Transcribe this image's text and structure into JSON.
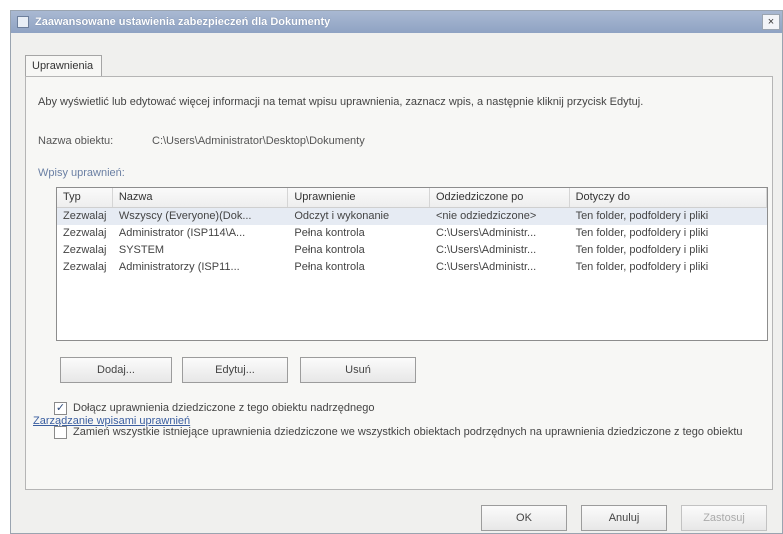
{
  "window": {
    "title": "Zaawansowane ustawienia zabezpieczeń dla Dokumenty",
    "close_glyph": "×"
  },
  "tabs": [
    {
      "label": "Uprawnienia"
    }
  ],
  "panel": {
    "intro_text": "Aby wyświetlić lub edytować więcej informacji na temat wpisu uprawnienia, zaznacz wpis, a następnie kliknij przycisk Edytuj.",
    "object_name_label": "Nazwa obiektu:",
    "object_name_value": "C:\\Users\\Administrator\\Desktop\\Dokumenty",
    "entries_label": "Wpisy uprawnień:"
  },
  "permissions_table": {
    "columns": [
      "Typ",
      "Nazwa",
      "Uprawnienie",
      "Odziedziczone po",
      "Dotyczy do"
    ],
    "rows": [
      [
        "Zezwalaj",
        "Wszyscy (Everyone)(Dok...",
        "Odczyt i wykonanie",
        "<nie odziedziczone>",
        "Ten folder, podfoldery i pliki"
      ],
      [
        "Zezwalaj",
        "Administrator (ISP114\\A...",
        "Pełna kontrola",
        "C:\\Users\\Administr...",
        "Ten folder, podfoldery i pliki"
      ],
      [
        "Zezwalaj",
        "SYSTEM",
        "Pełna kontrola",
        "C:\\Users\\Administr...",
        "Ten folder, podfoldery i pliki"
      ],
      [
        "Zezwalaj",
        "Administratorzy (ISP11...",
        "Pełna kontrola",
        "C:\\Users\\Administr...",
        "Ten folder, podfoldery i pliki"
      ]
    ]
  },
  "buttons": {
    "add": "Dodaj...",
    "edit": "Edytuj...",
    "remove": "Usuń"
  },
  "checkboxes": {
    "include_inheritable": {
      "label": "Dołącz uprawnienia dziedziczone z tego obiektu nadrzędnego",
      "checked": true,
      "mark": "✓"
    },
    "replace_child": {
      "label": "Zamień wszystkie istniejące uprawnienia dziedziczone we wszystkich obiektach podrzędnych na uprawnienia dziedziczone z tego obiektu",
      "checked": false,
      "mark": ""
    }
  },
  "link": {
    "label": "Zarządzanie wpisami uprawnień"
  },
  "footer_buttons": {
    "ok": "OK",
    "cancel": "Anuluj",
    "apply": "Zastosuj"
  }
}
